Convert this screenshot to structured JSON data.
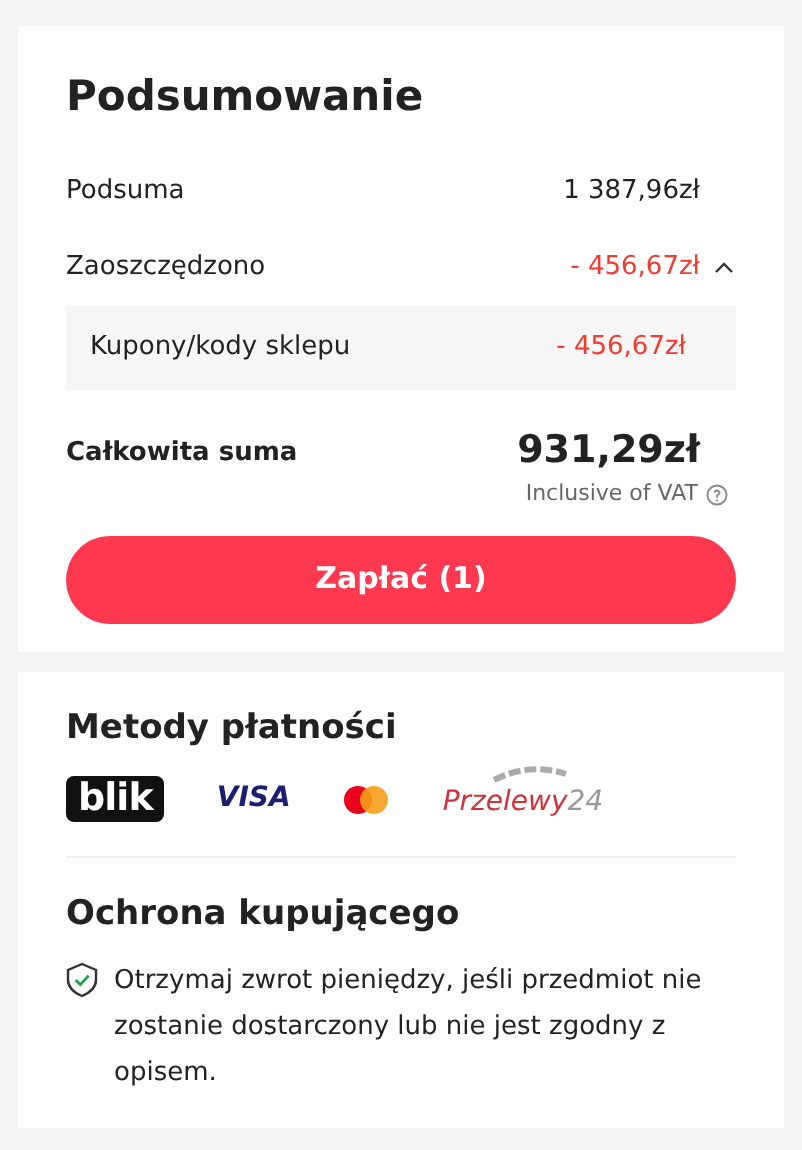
{
  "summary": {
    "title": "Podsumowanie",
    "rows": [
      {
        "label": "Podsuma",
        "value": "1 387,96zł",
        "kind": "plain"
      },
      {
        "label": "Zaoszczędzono",
        "value": "- 456,67zł",
        "kind": "discount",
        "expanded": true,
        "children": [
          {
            "label": "Kupony/kody sklepu",
            "value": "- 456,67zł"
          }
        ]
      }
    ],
    "total": {
      "label": "Całkowita suma",
      "value": "931,29zł",
      "note": "Inclusive of VAT"
    },
    "pay_button": "Zapłać (1)"
  },
  "payment_methods": {
    "title": "Metody płatności",
    "logos": [
      {
        "kind": "blik",
        "text": "blik"
      },
      {
        "kind": "visa",
        "text": "VISA"
      },
      {
        "kind": "mastercard"
      },
      {
        "kind": "p24",
        "text": "Przelewy",
        "suffix": "24"
      }
    ]
  },
  "protection": {
    "title": "Ochrona kupującego",
    "text": "Otrzymaj zwrot pieniędzy, jeśli przedmiot nie zostanie dostarczony lub nie jest zgodny z opisem."
  }
}
